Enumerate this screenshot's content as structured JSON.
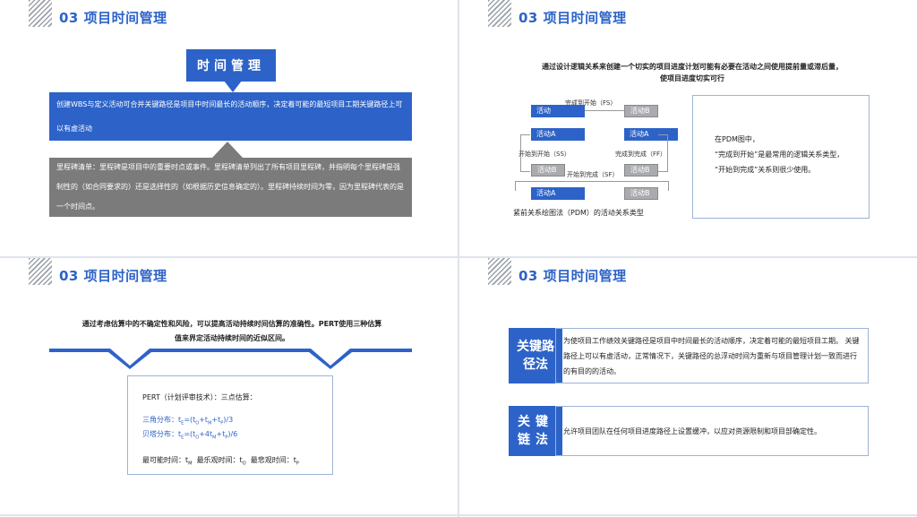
{
  "slide1": {
    "title": "03 项目时间管理",
    "box_title": "时间管理",
    "para1": "创建WBS与定义活动可合并关键路径是项目中时间最长的活动顺序，决定着可能的最短项目工期关键路径上可以有虚活动",
    "para2": "里程碑清单：里程碑是项目中的重要时点或事件。里程碑清单列出了所有项目里程碑，并指明每个里程碑是强制性的（如合同要求的）还是选择性的（如根据历史信息确定的）。里程碑持续时间为零，因为里程碑代表的是一个时间点。"
  },
  "slide2": {
    "title": "03 项目时间管理",
    "header_line1": "通过设计逻辑关系来创建一个切实的项目进度计划可能有必要在活动之间使用提前量或滞后量，",
    "header_line2": "使项目进度切实可行",
    "diagram": {
      "act": "活动",
      "actA": "活动A",
      "actB": "活动B",
      "fs": "完成到开始（FS）",
      "ss": "开始到开始（SS）",
      "ff": "完成到完成（FF）",
      "sf": "开始到完成（SF）",
      "caption": "紧前关系绘图法（PDM）的活动关系类型"
    },
    "note_line1": "在PDM图中，",
    "note_line2": "“完成到开始”是最常用的逻辑关系类型，",
    "note_line3": "“开始到完成”关系则很少使用。"
  },
  "slide3": {
    "title": "03 项目时间管理",
    "header_line1": "通过考虑估算中的不确定性和风险，可以提高活动持续时间估算的准确性。PERT使用三种估算",
    "header_line2": "值来界定活动持续时间的近似区间。",
    "pert_title": "PERT（计划评审技术）：三点估算：",
    "tri_label": "三角分布：",
    "tri_formula": "tE=(tO+tM+tP)/3",
    "beta_label": "贝塔分布：",
    "beta_formula": "tE=(tO+4tM+tP)/6",
    "likely": "最可能时间：tM",
    "optimistic": "最乐观时间：tO",
    "pessimistic": "最悲观时间：tP"
  },
  "slide4": {
    "title": "03 项目时间管理",
    "tag1": "关键路径法",
    "desc1": "为使项目工作绩效关键路径是项目中时间最长的活动顺序，决定着可能的最短项目工期。 关键路径上可以有虚活动，正常情况下，关键路径的总浮动时间为重新与项目管理计划一致而进行的有目的的活动。",
    "tag2": "关键链法",
    "desc2": "允许项目团队在任何项目进度路径上设置缓冲，以应对资源限制和项目部确定性。"
  },
  "colors": {
    "accent": "#2d63c8",
    "gray": "#7b7b7b"
  }
}
